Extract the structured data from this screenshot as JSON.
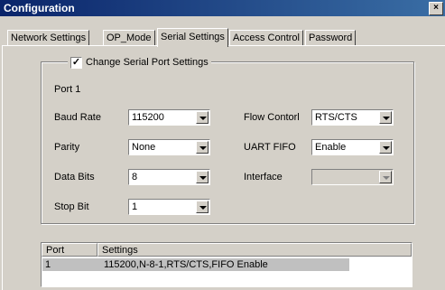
{
  "window": {
    "title": "Configuration",
    "close_label": "×"
  },
  "tabs": [
    {
      "label": "Network Settings",
      "active": false
    },
    {
      "label": "OP_Mode",
      "active": false
    },
    {
      "label": "Serial Settings",
      "active": true
    },
    {
      "label": "Access Control",
      "active": false
    },
    {
      "label": "Password",
      "active": false
    }
  ],
  "serial_group": {
    "checkbox_label": "Change Serial Port Settings",
    "checkbox_checked": true,
    "checkbox_mark": "✓",
    "port_label": "Port 1",
    "baud_rate": {
      "label": "Baud Rate",
      "value": "115200"
    },
    "parity": {
      "label": "Parity",
      "value": "None"
    },
    "data_bits": {
      "label": "Data Bits",
      "value": "8"
    },
    "stop_bit": {
      "label": "Stop Bit",
      "value": "1"
    },
    "flow_control": {
      "label": "Flow Contorl",
      "value": "RTS/CTS"
    },
    "uart_fifo": {
      "label": "UART FIFO",
      "value": "Enable"
    },
    "interface": {
      "label": "Interface",
      "value": "",
      "disabled": true
    }
  },
  "port_list": {
    "columns": [
      "Port",
      "Settings"
    ],
    "rows": [
      {
        "port": "1",
        "settings": "115200,N-8-1,RTS/CTS,FIFO Enable",
        "selected": true
      }
    ]
  },
  "colors": {
    "title_bar_start": "#0a246a",
    "title_bar_end": "#3a6ea5",
    "face": "#d4d0c8",
    "row_highlight": "#c0c0c0"
  }
}
